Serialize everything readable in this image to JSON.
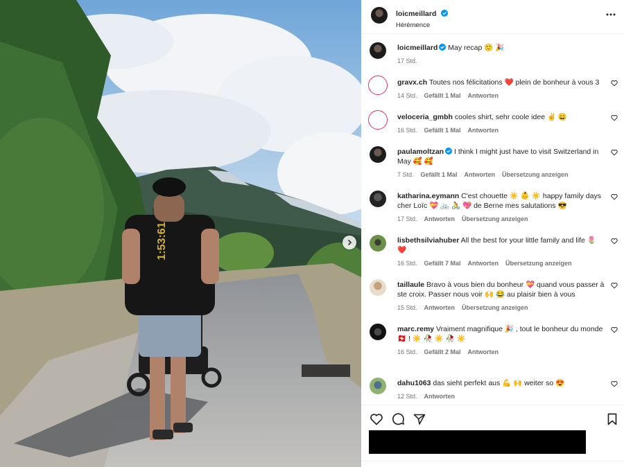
{
  "post": {
    "author": "loicmeillard",
    "location": "Hérémence",
    "caption": "May recap 🙂 🎉",
    "caption_age": "17 Std."
  },
  "photo": {
    "shirt_text": "1:53:61"
  },
  "comments": [
    {
      "user": "gravx.ch",
      "text": "Toutes nos félicitations ❤️  plein de bonheur à vous 3",
      "age": "14 Std.",
      "likes": "Gefällt 1 Mal",
      "reply": "Antworten",
      "translate": ""
    },
    {
      "user": "veloceria_gmbh",
      "text": "cooles shirt, sehr coole idee ✌️ 😄",
      "age": "16 Std.",
      "likes": "Gefällt 1 Mal",
      "reply": "Antworten",
      "translate": ""
    },
    {
      "user": "paulamoltzan",
      "text": "I think I might just have to visit Switzerland in May 🥰 🥰",
      "age": "7 Std.",
      "likes": "Gefällt 1 Mal",
      "reply": "Antworten",
      "translate": "Übersetzung anzeigen",
      "verified": true
    },
    {
      "user": "katharina.eymann",
      "text": "C'est chouette ☀️ 👶 ☀️  happy family days cher Loïc 💝 🚲 🚴 💖  de Berne mes salutations 😎",
      "age": "17 Std.",
      "likes": "",
      "reply": "Antworten",
      "translate": "Übersetzung anzeigen"
    },
    {
      "user": "lisbethsilviahuber",
      "text": "All the best for your little family and life 🌷 ❤️",
      "age": "16 Std.",
      "likes": "Gefällt 7 Mal",
      "reply": "Antworten",
      "translate": "Übersetzung anzeigen"
    },
    {
      "user": "taillaule",
      "text": "Bravo à vous bien du bonheur 💝 quand vous passer à ste croix. Passer nous voir 🙌 😂  au plaisir bien à vous",
      "age": "15 Std.",
      "likes": "",
      "reply": "Antworten",
      "translate": "Übersetzung anzeigen"
    },
    {
      "user": "marc.remy",
      "text": "Vraiment magnifique 🎉 , tout le bonheur du monde 🇨🇭 !  ☀️ 🥀 ☀️ 🥀 ☀️",
      "age": "16 Std.",
      "likes": "Gefällt 2 Mal",
      "reply": "Antworten",
      "translate": ""
    },
    {
      "user": "dahu1063",
      "text": "das sieht perfekt aus 💪 🙌  weiter so 😍",
      "age": "12 Std.",
      "likes": "",
      "reply": "Antworten",
      "translate": ""
    }
  ],
  "icons": {
    "like": "heart-icon",
    "comment": "comment-icon",
    "share": "share-icon",
    "save": "bookmark-icon",
    "more": "more-icon"
  },
  "colors": {
    "verified": "#0095f6",
    "muted": "#737373",
    "text": "#262626"
  }
}
